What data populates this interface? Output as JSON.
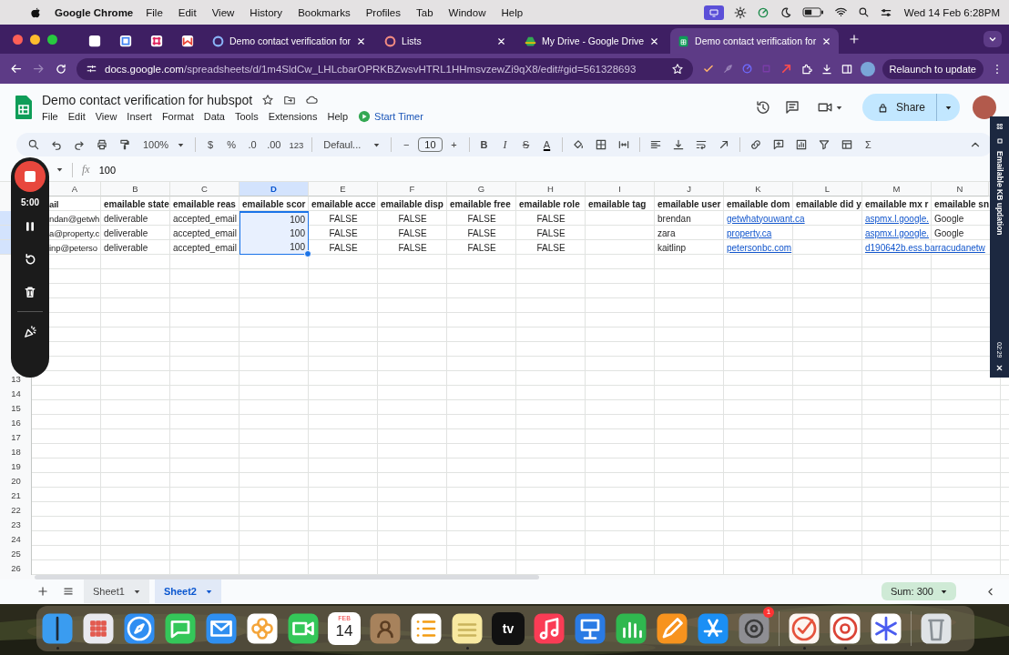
{
  "menubar": {
    "app": "Google Chrome",
    "menus": [
      "File",
      "Edit",
      "View",
      "History",
      "Bookmarks",
      "Profiles",
      "Tab",
      "Window",
      "Help"
    ],
    "clock": "Wed 14 Feb  6:28PM"
  },
  "tabs": [
    {
      "kind": "check",
      "selected": false
    },
    {
      "kind": "calendar",
      "selected": false
    },
    {
      "kind": "slack",
      "selected": false
    },
    {
      "kind": "gmail",
      "selected": false
    },
    {
      "kind": "loop",
      "title": "Demo contact verification for",
      "selected": false
    },
    {
      "kind": "lists",
      "title": "Lists",
      "selected": false
    },
    {
      "kind": "drive",
      "title": "My Drive - Google Drive",
      "selected": false
    },
    {
      "kind": "sheets",
      "title": "Demo contact verification for",
      "selected": true
    }
  ],
  "address_bar": {
    "host": "docs.google.com",
    "path": "/spreadsheets/d/1m4SldCw_LHLcbarOPRKBZwsvHTRL1HHmsvzewZi9qX8/edit#gid=561328693",
    "relaunch": "Relaunch to update"
  },
  "document": {
    "title": "Demo contact verification for hubspot",
    "menus": [
      "File",
      "Edit",
      "View",
      "Insert",
      "Format",
      "Data",
      "Tools",
      "Extensions",
      "Help"
    ],
    "timer": "Start Timer",
    "share": "Share"
  },
  "toolbar": {
    "zoom": "100%",
    "currency": "$",
    "percent": "%",
    "decrease_decimal": ".0",
    "increase_decimal": ".00",
    "number_format": "123",
    "font": "Defaul...",
    "minus": "−",
    "font_size": "10",
    "plus": "+",
    "bold": "B",
    "italic": "I",
    "strikethrough": "S",
    "text_color": "A",
    "functions": "Σ"
  },
  "formula_bar": {
    "fx": "fx",
    "value": "100"
  },
  "grid": {
    "columns": [
      {
        "letter": "A",
        "kind": "text",
        "selected": false
      },
      {
        "letter": "B",
        "kind": "text",
        "selected": false
      },
      {
        "letter": "C",
        "kind": "text",
        "selected": false
      },
      {
        "letter": "D",
        "kind": "number",
        "selected": true
      },
      {
        "letter": "E",
        "kind": "boolean",
        "selected": false
      },
      {
        "letter": "F",
        "kind": "boolean",
        "selected": false
      },
      {
        "letter": "G",
        "kind": "boolean",
        "selected": false
      },
      {
        "letter": "H",
        "kind": "boolean",
        "selected": false
      },
      {
        "letter": "I",
        "kind": "text",
        "selected": false
      },
      {
        "letter": "J",
        "kind": "text",
        "selected": false
      },
      {
        "letter": "K",
        "kind": "link",
        "selected": false
      },
      {
        "letter": "L",
        "kind": "text",
        "selected": false
      },
      {
        "letter": "M",
        "kind": "link",
        "selected": false
      },
      {
        "letter": "N",
        "kind": "text",
        "selected": false
      }
    ],
    "rows": [
      {
        "kind": "header",
        "selected": false,
        "cells": [
          "ail",
          "emailable state",
          "emailable reas",
          "emailable scor",
          "emailable acce",
          "emailable disp",
          "emailable free",
          "emailable role",
          "emailable tag",
          "emailable user",
          "emailable dom",
          "emailable did y",
          "emailable mx r",
          "emailable sn"
        ]
      },
      {
        "kind": "data",
        "selected": true,
        "cells": [
          "ndan@getwh",
          "deliverable",
          "accepted_email",
          "100",
          "FALSE",
          "FALSE",
          "FALSE",
          "FALSE",
          null,
          "brendan",
          "getwhatyouwant.ca",
          null,
          "aspmx.l.google.",
          "Google"
        ]
      },
      {
        "kind": "data",
        "selected": true,
        "cells": [
          "a@property.c",
          "deliverable",
          "accepted_email",
          "100",
          "FALSE",
          "FALSE",
          "FALSE",
          "FALSE",
          null,
          "zara",
          "property.ca",
          null,
          "aspmx.l.google.",
          "Google"
        ]
      },
      {
        "kind": "data",
        "selected": true,
        "cells": [
          "inp@peterso",
          "deliverable",
          "accepted_email",
          "100",
          "FALSE",
          "FALSE",
          "FALSE",
          "FALSE",
          null,
          "kaitlinp",
          "petersonbc.com",
          null,
          "d190642b.ess.barracudanetw",
          null
        ]
      }
    ],
    "blank_row_numbers": [
      "13",
      "14",
      "15",
      "16",
      "17",
      "18",
      "19",
      "20",
      "21",
      "22",
      "23",
      "24",
      "25",
      "26"
    ]
  },
  "recorder": {
    "time": "5:00"
  },
  "side_panel": {
    "title": "Emailable KB updation",
    "time": "02:29"
  },
  "sheet_tabs": [
    {
      "name": "Sheet1",
      "selected": false
    },
    {
      "name": "Sheet2",
      "selected": true
    }
  ],
  "sum": "Sum: 300",
  "dock": [
    {
      "kind": "finder",
      "running": true
    },
    {
      "kind": "launchpad",
      "running": false
    },
    {
      "kind": "safari",
      "running": false
    },
    {
      "kind": "messages",
      "running": false
    },
    {
      "kind": "mail",
      "running": false
    },
    {
      "kind": "photos",
      "running": false
    },
    {
      "kind": "facetime",
      "running": false
    },
    {
      "kind": "calendar",
      "month": "FEB",
      "day": "14",
      "running": false
    },
    {
      "kind": "contacts",
      "running": false
    },
    {
      "kind": "reminders",
      "running": false
    },
    {
      "kind": "notes",
      "running": true
    },
    {
      "kind": "tv",
      "label": "tv",
      "running": false
    },
    {
      "kind": "music",
      "running": false
    },
    {
      "kind": "keynote",
      "running": false
    },
    {
      "kind": "numbers",
      "running": false
    },
    {
      "kind": "pages",
      "running": false
    },
    {
      "kind": "appstore",
      "running": false
    },
    {
      "kind": "settings",
      "badge": "1",
      "running": false
    },
    {
      "kind": "separator"
    },
    {
      "kind": "checker",
      "running": true
    },
    {
      "kind": "chrome",
      "running": true
    },
    {
      "kind": "asterisk",
      "running": false
    },
    {
      "kind": "separator"
    },
    {
      "kind": "trash",
      "running": false
    }
  ]
}
